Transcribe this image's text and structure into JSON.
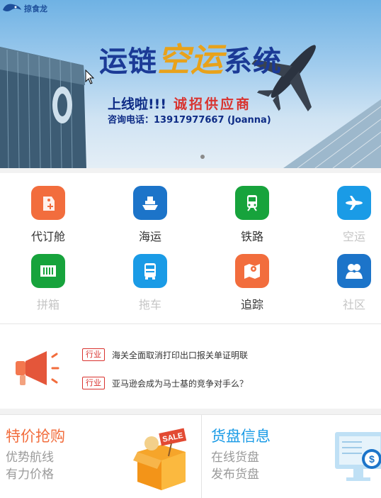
{
  "banner": {
    "logo_text": "掠食龙",
    "title_part1": "运链",
    "title_part2": "空运",
    "title_part3": "系统",
    "launch_text": "上线啦!!!",
    "recruit_text": "诚招供应商",
    "phone_line": "咨询电话：13917977667 (Joanna)",
    "slide_count": 1
  },
  "services": [
    {
      "label": "代订舱",
      "icon": "booking-tag-icon",
      "color": "#f26d3d",
      "enabled": true
    },
    {
      "label": "海运",
      "icon": "ship-icon",
      "color": "#1c74c9",
      "enabled": true
    },
    {
      "label": "铁路",
      "icon": "train-icon",
      "color": "#17a33c",
      "enabled": true
    },
    {
      "label": "空运",
      "icon": "airplane-icon",
      "color": "#1a9be6",
      "enabled": false
    },
    {
      "label": "拼箱",
      "icon": "container-icon",
      "color": "#17a33c",
      "enabled": false
    },
    {
      "label": "拖车",
      "icon": "truck-icon",
      "color": "#1a9be6",
      "enabled": false
    },
    {
      "label": "追踪",
      "icon": "map-track-icon",
      "color": "#f26d3d",
      "enabled": true
    },
    {
      "label": "社区",
      "icon": "community-icon",
      "color": "#1c74c9",
      "enabled": false
    }
  ],
  "news": {
    "items": [
      {
        "tag": "行业",
        "title": "海关全面取消打印出口报关单证明联"
      },
      {
        "tag": "行业",
        "title": "亚马逊会成为马士基的竞争对手么？"
      }
    ]
  },
  "promo": {
    "left": {
      "title": "特价抢购",
      "line1": "优势航线",
      "line2": "有力价格",
      "sale_label": "SALE"
    },
    "right": {
      "title": "货盘信息",
      "line1": "在线货盘",
      "line2": "发布货盘",
      "currency_symbol": "$"
    }
  },
  "colors": {
    "orange": "#f26d3d",
    "blue": "#1a9be6",
    "green": "#17a33c",
    "red": "#d9322e",
    "dark_blue": "#1b3a96"
  }
}
